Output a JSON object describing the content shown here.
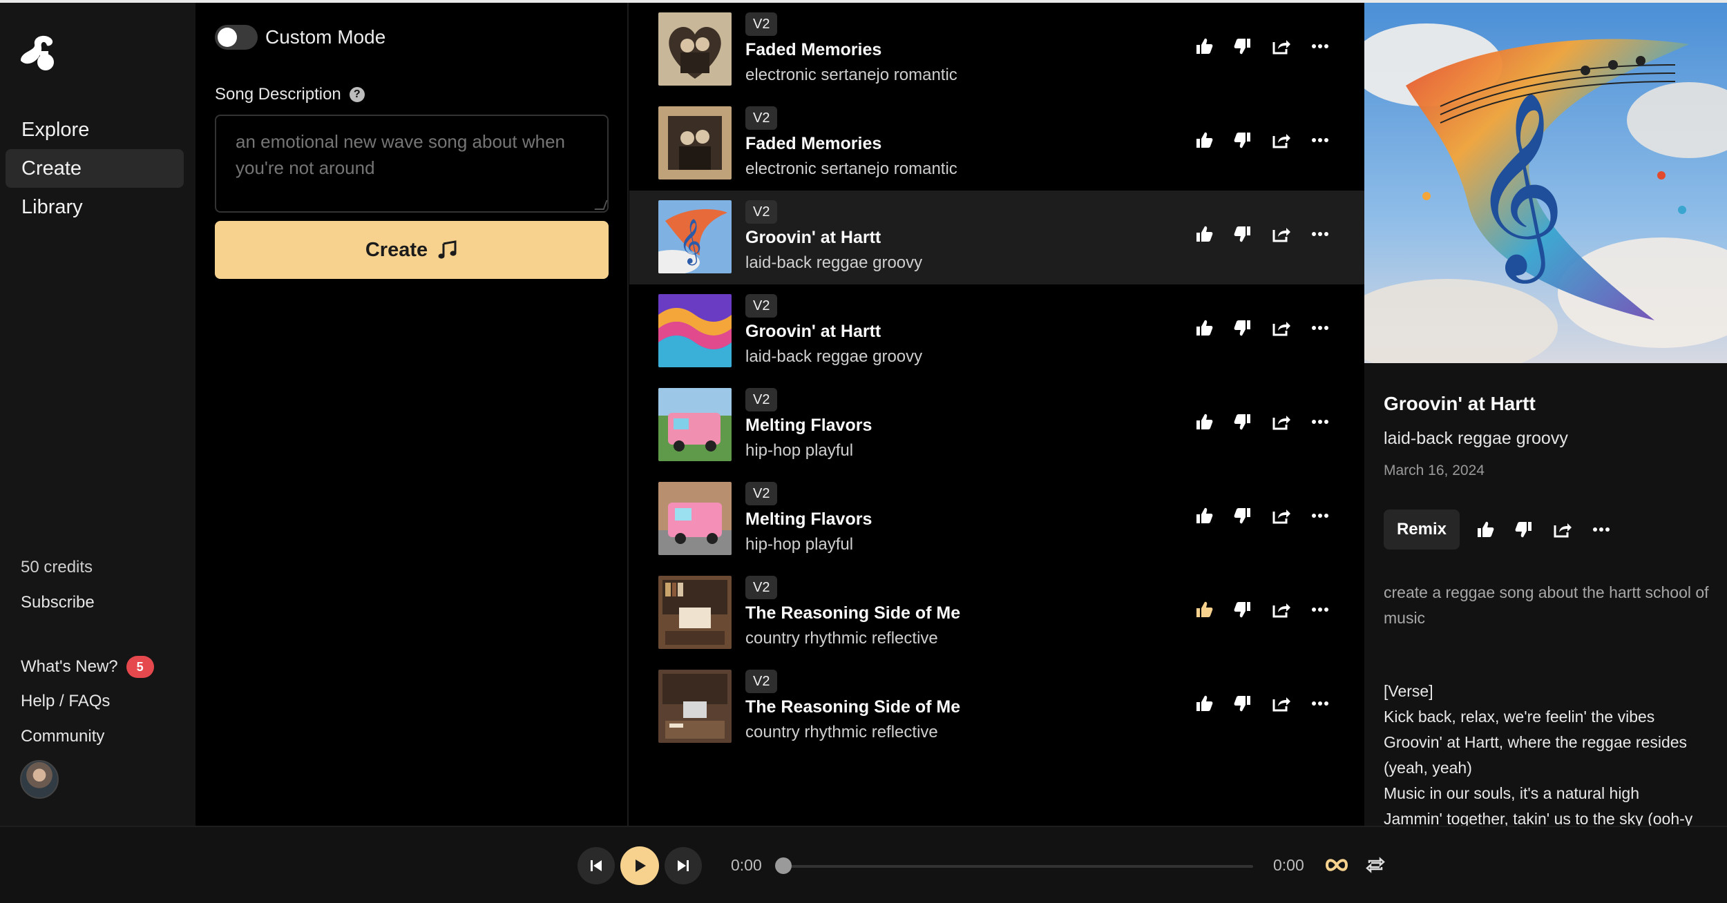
{
  "sidebar": {
    "nav": [
      {
        "label": "Explore",
        "active": false
      },
      {
        "label": "Create",
        "active": true
      },
      {
        "label": "Library",
        "active": false
      }
    ],
    "credits": "50 credits",
    "subscribe": "Subscribe",
    "whats_new": "What's New?",
    "whats_new_count": "5",
    "help": "Help / FAQs",
    "community": "Community"
  },
  "create": {
    "custom_mode_label": "Custom Mode",
    "custom_mode_on": false,
    "description_label": "Song Description",
    "description_placeholder": "an emotional new wave song about when you're not around",
    "create_button": "Create"
  },
  "songs": [
    {
      "version": "V2",
      "title": "Faded Memories",
      "tags": "electronic sertanejo romantic",
      "liked": false,
      "art": "vintage-couple-heart"
    },
    {
      "version": "V2",
      "title": "Faded Memories",
      "tags": "electronic sertanejo romantic",
      "liked": false,
      "art": "vintage-couple-frame"
    },
    {
      "version": "V2",
      "title": "Groovin' at Hartt",
      "tags": "laid-back reggae groovy",
      "liked": false,
      "art": "music-swirl-sky",
      "active": true
    },
    {
      "version": "V2",
      "title": "Groovin' at Hartt",
      "tags": "laid-back reggae groovy",
      "liked": false,
      "art": "rainbow-waves"
    },
    {
      "version": "V2",
      "title": "Melting Flavors",
      "tags": "hip-hop playful",
      "liked": false,
      "art": "ice-cream-truck-park"
    },
    {
      "version": "V2",
      "title": "Melting Flavors",
      "tags": "hip-hop playful",
      "liked": false,
      "art": "ice-cream-truck-street"
    },
    {
      "version": "V2",
      "title": "The Reasoning Side of Me",
      "tags": "country rhythmic reflective",
      "liked": true,
      "art": "bookshelf-desk"
    },
    {
      "version": "V2",
      "title": "The Reasoning Side of Me",
      "tags": "country rhythmic reflective",
      "liked": false,
      "art": "study-room"
    }
  ],
  "detail": {
    "title": "Groovin' at Hartt",
    "tags": "laid-back reggae groovy",
    "date": "March 16, 2024",
    "remix_label": "Remix",
    "prompt": "create a reggae song about the hartt school of music",
    "lyrics": "[Verse]\nKick back, relax, we're feelin' the vibes\nGroovin' at Hartt, where the reggae resides\n(yeah, yeah)\nMusic in our souls, it's a natural high\nJammin' together, takin' us to the sky (ooh-y"
  },
  "player": {
    "current_time": "0:00",
    "total_time": "0:00",
    "progress": 0
  },
  "colors": {
    "accent": "#f7d28e",
    "badge": "#e5484d",
    "sidebar_bg": "#151515",
    "active_row": "#1d1d1d"
  }
}
